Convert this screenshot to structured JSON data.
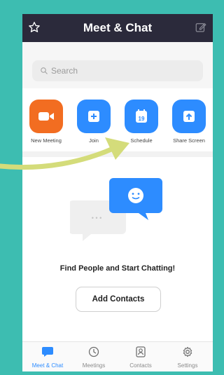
{
  "header": {
    "title": "Meet & Chat",
    "left_icon": "star-icon",
    "right_icon": "edit-icon"
  },
  "search": {
    "placeholder": "Search"
  },
  "actions": [
    {
      "label": "New Meeting",
      "icon": "video-camera-icon",
      "color": "#f26d21"
    },
    {
      "label": "Join",
      "icon": "plus-icon",
      "color": "#2d8cff"
    },
    {
      "label": "Schedule",
      "icon": "calendar-icon",
      "color": "#2d8cff",
      "badge": "19"
    },
    {
      "label": "Share Screen",
      "icon": "share-up-icon",
      "color": "#2d8cff"
    }
  ],
  "empty_state": {
    "title": "Find People and Start Chatting!",
    "button": "Add Contacts",
    "dots": "• • •"
  },
  "tabs": [
    {
      "label": "Meet & Chat",
      "icon": "chat-bubble-icon",
      "active": true
    },
    {
      "label": "Meetings",
      "icon": "clock-icon",
      "active": false
    },
    {
      "label": "Contacts",
      "icon": "contacts-icon",
      "active": false
    },
    {
      "label": "Settings",
      "icon": "gear-icon",
      "active": false
    }
  ],
  "colors": {
    "background": "#3dbdb1",
    "header": "#2b2a3b",
    "accent": "#2d8cff",
    "arrow": "#d4dc7a"
  }
}
